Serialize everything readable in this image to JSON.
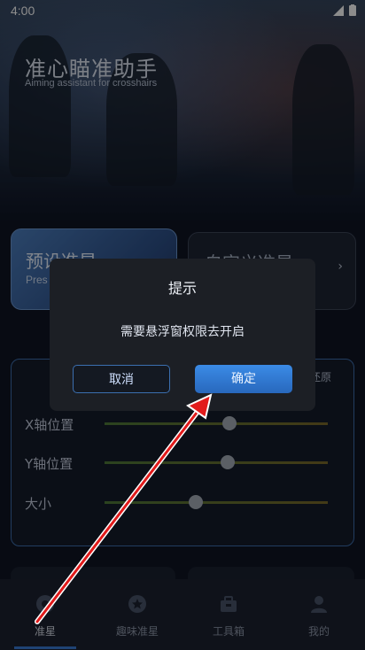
{
  "status": {
    "time": "4:00"
  },
  "header": {
    "title": "准心瞄准助手",
    "subtitle": "Aiming assistant for crosshairs"
  },
  "cards": [
    {
      "title": "预设准星",
      "subtitle": "Pres"
    },
    {
      "title": "自定义准星",
      "arrow": "›"
    }
  ],
  "panel": {
    "restore_label": "还原",
    "rows": [
      {
        "label": "X轴位置",
        "value": 0.56
      },
      {
        "label": "Y轴位置",
        "value": 0.55
      },
      {
        "label": "大小",
        "value": 0.41
      }
    ]
  },
  "nav": {
    "items": [
      {
        "label": "准星",
        "icon": "crosshair-icon",
        "active": true
      },
      {
        "label": "趣味准星",
        "icon": "star-icon",
        "active": false
      },
      {
        "label": "工具箱",
        "icon": "toolbox-icon",
        "active": false
      },
      {
        "label": "我的",
        "icon": "person-icon",
        "active": false
      }
    ]
  },
  "dialog": {
    "title": "提示",
    "message": "需要悬浮窗权限去开启",
    "cancel_label": "取消",
    "confirm_label": "确定"
  },
  "colors": {
    "accent": "#3b8be6",
    "annotation_arrow": "#e21b1b"
  }
}
